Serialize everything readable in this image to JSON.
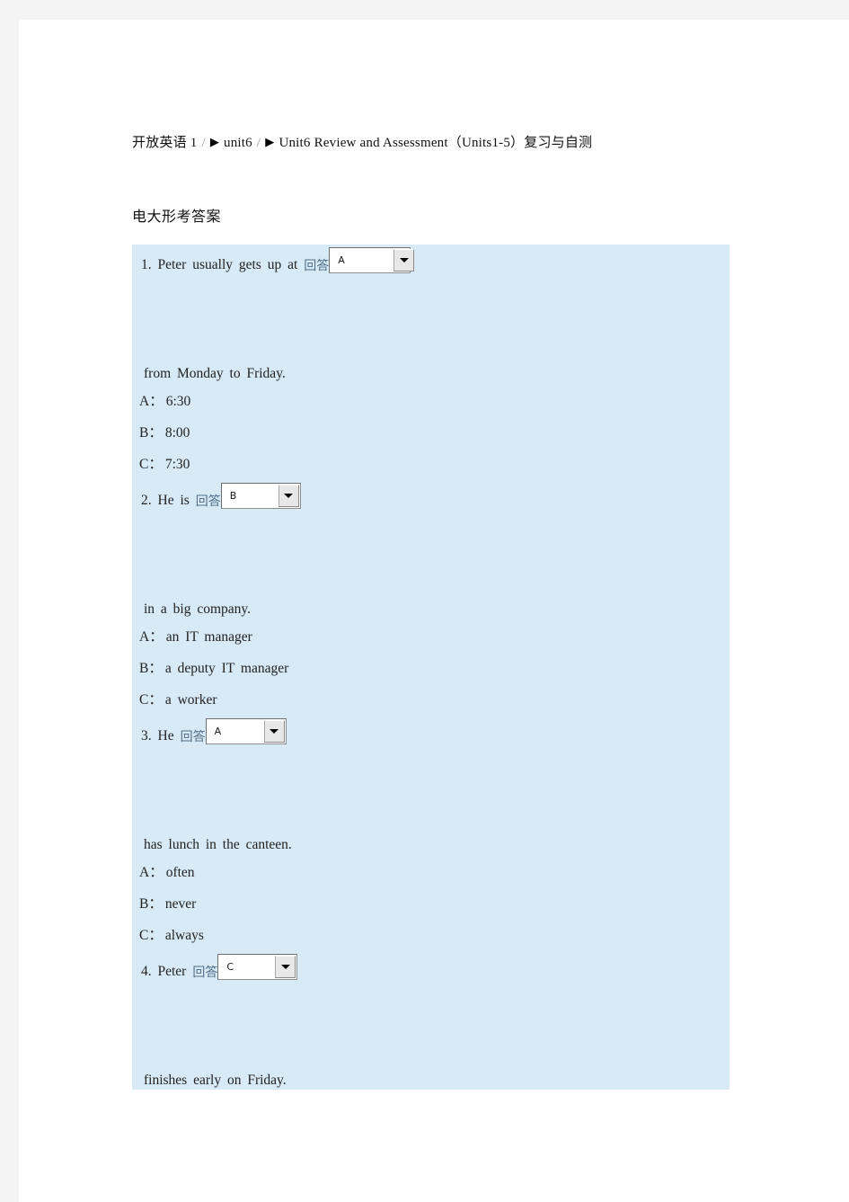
{
  "breadcrumb": {
    "name": "breadcrumb-trail",
    "root": "开放英语 1",
    "separator": "/",
    "arrow_glyph": "▶",
    "items": [
      {
        "label": "unit6"
      },
      {
        "label": "Unit6 Review and Assessment（Units1-5）复习与自测"
      }
    ]
  },
  "subtitle": "电大形考答案",
  "quiz": {
    "panel_color": "#d7eaf6",
    "answer_label": "回答",
    "questions": [
      {
        "number": "1.",
        "stem": "1. Peter usually gets up at",
        "selected": "A",
        "tail": " from Monday to Friday.",
        "options": [
          {
            "key": "A：",
            "text": "6:30"
          },
          {
            "key": "B：",
            "text": "8:00"
          },
          {
            "key": "C：",
            "text": "7:30"
          }
        ]
      },
      {
        "number": "2.",
        "stem": "2. He is",
        "selected": "B",
        "tail": " in a big company.",
        "options": [
          {
            "key": "A：",
            "text": "an IT manager"
          },
          {
            "key": "B：",
            "text": "a deputy IT manager"
          },
          {
            "key": "C：",
            "text": "a worker"
          }
        ]
      },
      {
        "number": "3.",
        "stem": "3. He",
        "selected": "A",
        "tail": " has lunch in the canteen.",
        "options": [
          {
            "key": "A：",
            "text": "often"
          },
          {
            "key": "B：",
            "text": "never"
          },
          {
            "key": "C：",
            "text": "always"
          }
        ]
      },
      {
        "number": "4.",
        "stem": "4. Peter",
        "selected": "C",
        "tail": " finishes early on Friday.",
        "options": []
      }
    ]
  }
}
